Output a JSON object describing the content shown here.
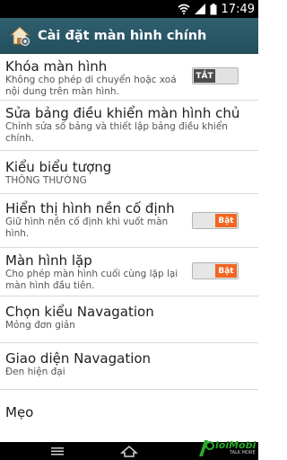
{
  "status_bar": {
    "time": "17:49"
  },
  "action_bar": {
    "title": "Cài đặt màn hình chính",
    "icon": "home-settings-icon"
  },
  "settings": [
    {
      "title": "Khóa màn hình",
      "subtitle": "Không cho phép di chuyển hoặc xoá nội dung trên màn hình.",
      "toggle": "off",
      "toggle_label": "TẮT"
    },
    {
      "title": "Sửa bảng điều khiển màn hình chủ",
      "subtitle": "Chỉnh sửa số bảng và thiết lập bảng điều khiển chính."
    },
    {
      "title": "Kiểu biểu tượng",
      "subtitle": "THÔNG THƯỜNG"
    },
    {
      "title": "Hiển thị hình nền cố định",
      "subtitle": "Giữ hình nền cố định khi vuốt màn hình.",
      "toggle": "on",
      "toggle_label": "Bật"
    },
    {
      "title": "Màn hình lặp",
      "subtitle": "Cho phép màn hình cuối cùng lặp lại màn hình đầu tiên.",
      "toggle": "on",
      "toggle_label": "Bật"
    },
    {
      "title": "Chọn kiểu Navagation",
      "subtitle": "Mỏng đơn giản"
    },
    {
      "title": "Giao diện Navagation",
      "subtitle": "Đen hiện đại"
    },
    {
      "title": "Mẹo",
      "subtitle": ""
    }
  ],
  "watermark": {
    "brand": "loiMobi",
    "tagline": "TALK MORE"
  },
  "colors": {
    "action_bar": "#2a5866",
    "toggle_on": "#f26522",
    "toggle_off": "#4d4d4d"
  }
}
